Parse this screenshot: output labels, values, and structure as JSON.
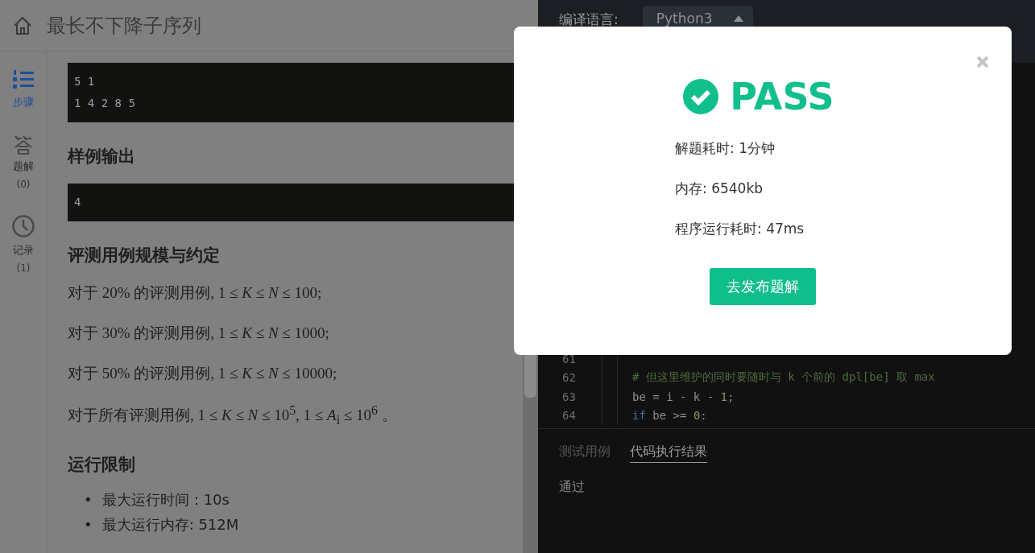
{
  "header": {
    "title": "最长不下降子序列"
  },
  "sidebar": {
    "items": [
      {
        "kind": "steps",
        "label": "步骤",
        "selected": true
      },
      {
        "kind": "solutions",
        "label": "题解",
        "count": "(0)",
        "selected": false
      },
      {
        "kind": "records",
        "label": "记录",
        "count": "(1)",
        "selected": false
      }
    ]
  },
  "content": {
    "input_sample": [
      "5 1",
      "1 4 2 8 5"
    ],
    "output_heading": "样例输出",
    "output_sample": [
      "4"
    ],
    "scale_heading": "评测用例规模与约定",
    "scale_lines": [
      "对于 20% 的评测用例, 1 ≤ *K* ≤ *N* ≤ 100;",
      "对于 30% 的评测用例, 1 ≤ *K* ≤ *N* ≤ 1000;",
      "对于 50% 的评测用例, 1 ≤ *K* ≤ *N* ≤ 10000;",
      "对于所有评测用例, 1 ≤ *K* ≤ *N* ≤ 10$^{5}$, 1 ≤ *A*$_{i}$ ≤ 10$^{6}$ 。"
    ],
    "limits_heading": "运行限制",
    "limits": [
      {
        "marker": "•",
        "text": "最大运行时间：10s"
      },
      {
        "marker": "•",
        "text": "最大运行内存: 512M"
      }
    ]
  },
  "editor": {
    "language_label": "编译语言:",
    "language": "Python3",
    "lines": [
      {
        "number": "61"
      },
      {
        "number": "62",
        "tokens": [
          {
            "text": "# 但这里维护的同时要随时与 k 个前的 dpl[be] 取 max",
            "kind": "comment"
          }
        ]
      },
      {
        "number": "63",
        "tokens": [
          {
            "text": "be = i - k - ",
            "kind": "plain"
          },
          {
            "text": "1",
            "kind": "number"
          },
          {
            "text": ";",
            "kind": "plain"
          }
        ]
      },
      {
        "number": "64",
        "tokens": [
          {
            "text": "if",
            "kind": "keyword"
          },
          {
            "text": " be >= ",
            "kind": "plain"
          },
          {
            "text": "0",
            "kind": "number"
          },
          {
            "text": ":",
            "kind": "plain"
          }
        ]
      }
    ]
  },
  "result_panel": {
    "tabs": [
      {
        "label": "测试用例",
        "selected": false
      },
      {
        "label": "代码执行结果",
        "selected": true
      }
    ],
    "result": "通过"
  },
  "dialog": {
    "status": "PASS",
    "stats": [
      "解题耗时: 1分钟",
      "内存: 6540kb",
      "程序运行耗时: 47ms"
    ],
    "button": "去发布题解"
  }
}
